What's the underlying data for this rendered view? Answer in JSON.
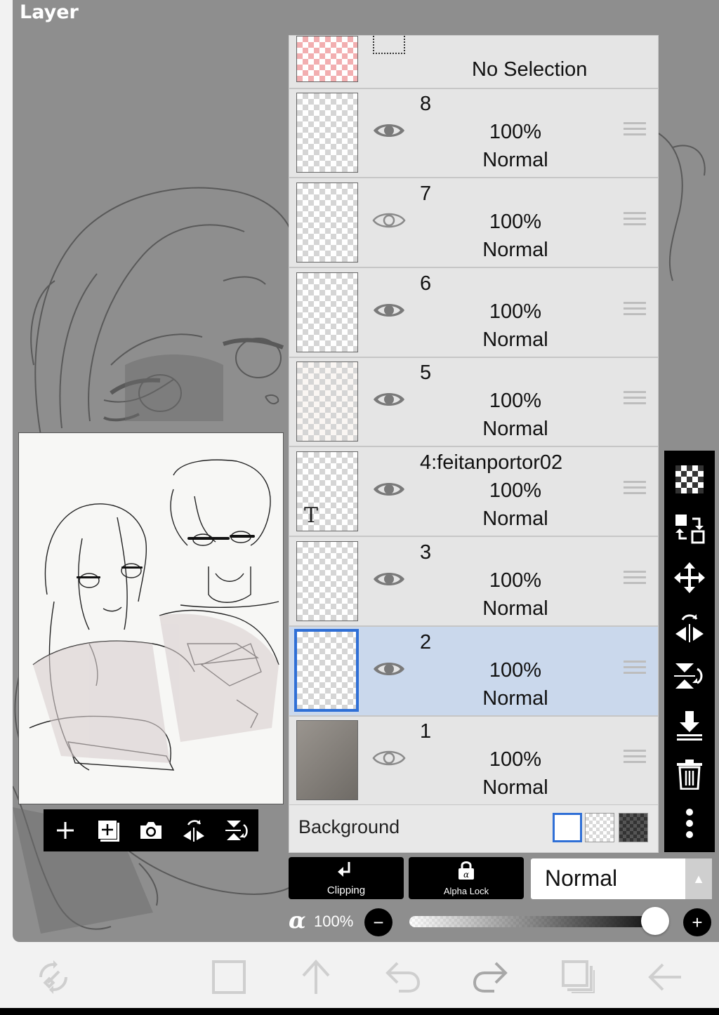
{
  "header": {
    "title": "Layer"
  },
  "selection": {
    "label": "No Selection"
  },
  "layers": [
    {
      "name": "8",
      "opacity": "100%",
      "mode": "Normal",
      "visible": true,
      "active": false
    },
    {
      "name": "7",
      "opacity": "100%",
      "mode": "Normal",
      "visible": false,
      "active": false
    },
    {
      "name": "6",
      "opacity": "100%",
      "mode": "Normal",
      "visible": true,
      "active": false
    },
    {
      "name": "5",
      "opacity": "100%",
      "mode": "Normal",
      "visible": true,
      "active": false
    },
    {
      "name": "4:feitanportor02",
      "opacity": "100%",
      "mode": "Normal",
      "visible": true,
      "active": false,
      "thumb_text": "T"
    },
    {
      "name": "3",
      "opacity": "100%",
      "mode": "Normal",
      "visible": true,
      "active": false
    },
    {
      "name": "2",
      "opacity": "100%",
      "mode": "Normal",
      "visible": true,
      "active": true
    },
    {
      "name": "1",
      "opacity": "100%",
      "mode": "Normal",
      "visible": false,
      "active": false
    }
  ],
  "background": {
    "label": "Background",
    "swatches": [
      "white",
      "checker",
      "dark-checker"
    ],
    "selected": "white"
  },
  "buttons": {
    "clipping": "Clipping",
    "alpha_lock": "Alpha Lock"
  },
  "blend_mode": {
    "value": "Normal"
  },
  "alpha": {
    "symbol": "α",
    "value": "100%",
    "minus": "−",
    "plus": "+",
    "level": 1.0
  },
  "preview_toolbar": [
    "add-layer-icon",
    "add-copy-icon",
    "camera-icon",
    "flip-horizontal-icon",
    "flip-vertical-icon"
  ],
  "right_toolbar": [
    "transparency-icon",
    "swap-icon",
    "move-icon",
    "flip-horizontal-icon",
    "flip-vertical-icon",
    "merge-down-icon",
    "trash-icon",
    "more-icon"
  ],
  "bottom_nav": [
    "brush-settings-icon",
    "selection-icon",
    "export-icon",
    "undo-icon",
    "redo-icon",
    "layers-icon",
    "back-icon"
  ],
  "colors": {
    "accent": "#2f6fd6",
    "active_row": "#cad8ec",
    "canvas_bg": "#8e8e8e",
    "panel_bg": "#e5e5e5"
  }
}
